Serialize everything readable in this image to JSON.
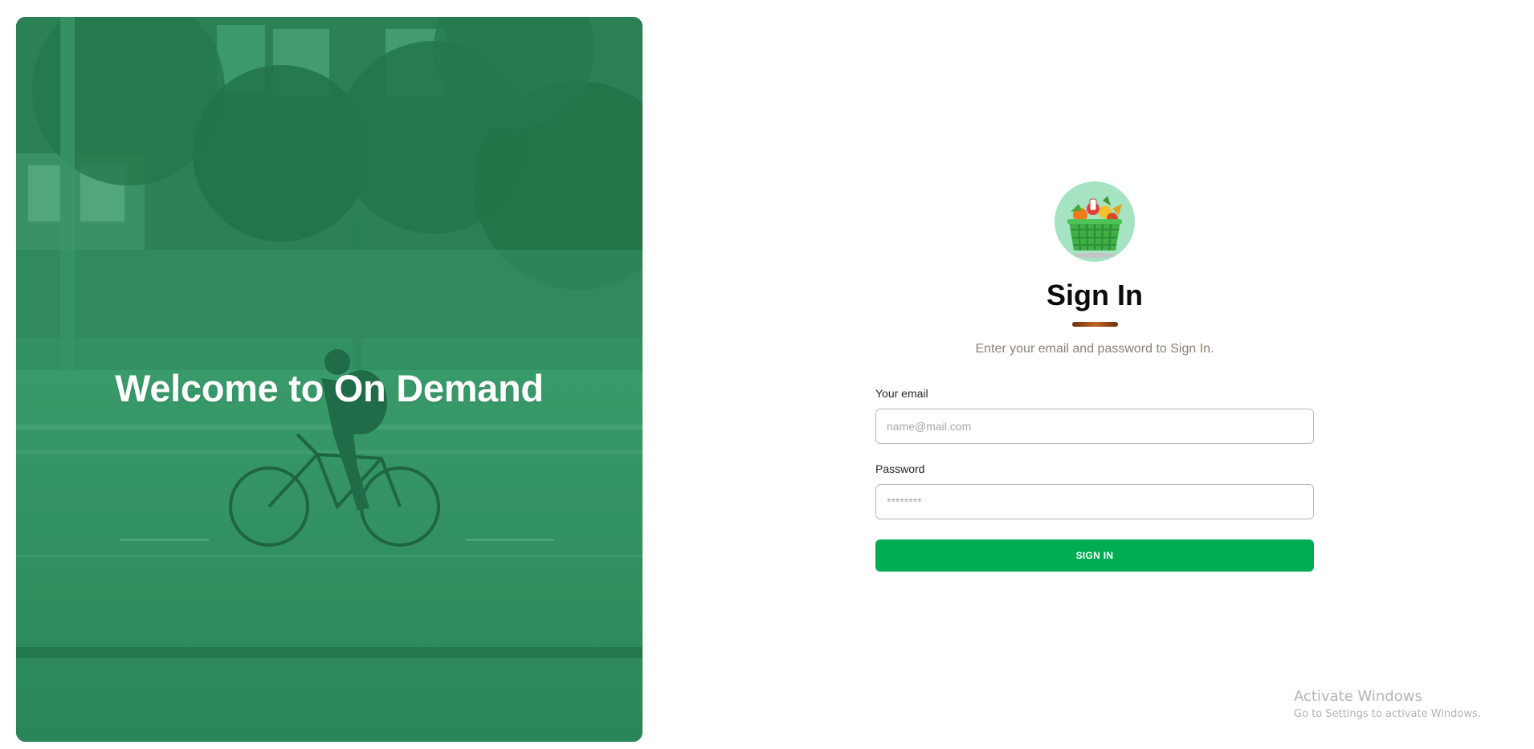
{
  "hero": {
    "title": "Welcome to On Demand"
  },
  "logo": {
    "icon": "grocery-basket-icon"
  },
  "form": {
    "title": "Sign In",
    "subtitle": "Enter your email and password to Sign In.",
    "email_label": "Your email",
    "email_placeholder": "name@mail.com",
    "email_value": "",
    "password_label": "Password",
    "password_placeholder": "********",
    "password_value": "",
    "submit_label": "SIGN IN"
  },
  "watermark": {
    "title": "Activate Windows",
    "subtitle": "Go to Settings to activate Windows."
  },
  "colors": {
    "accent": "#00ac52",
    "hero_overlay": "#2f9062",
    "underline": "#a24f17"
  }
}
